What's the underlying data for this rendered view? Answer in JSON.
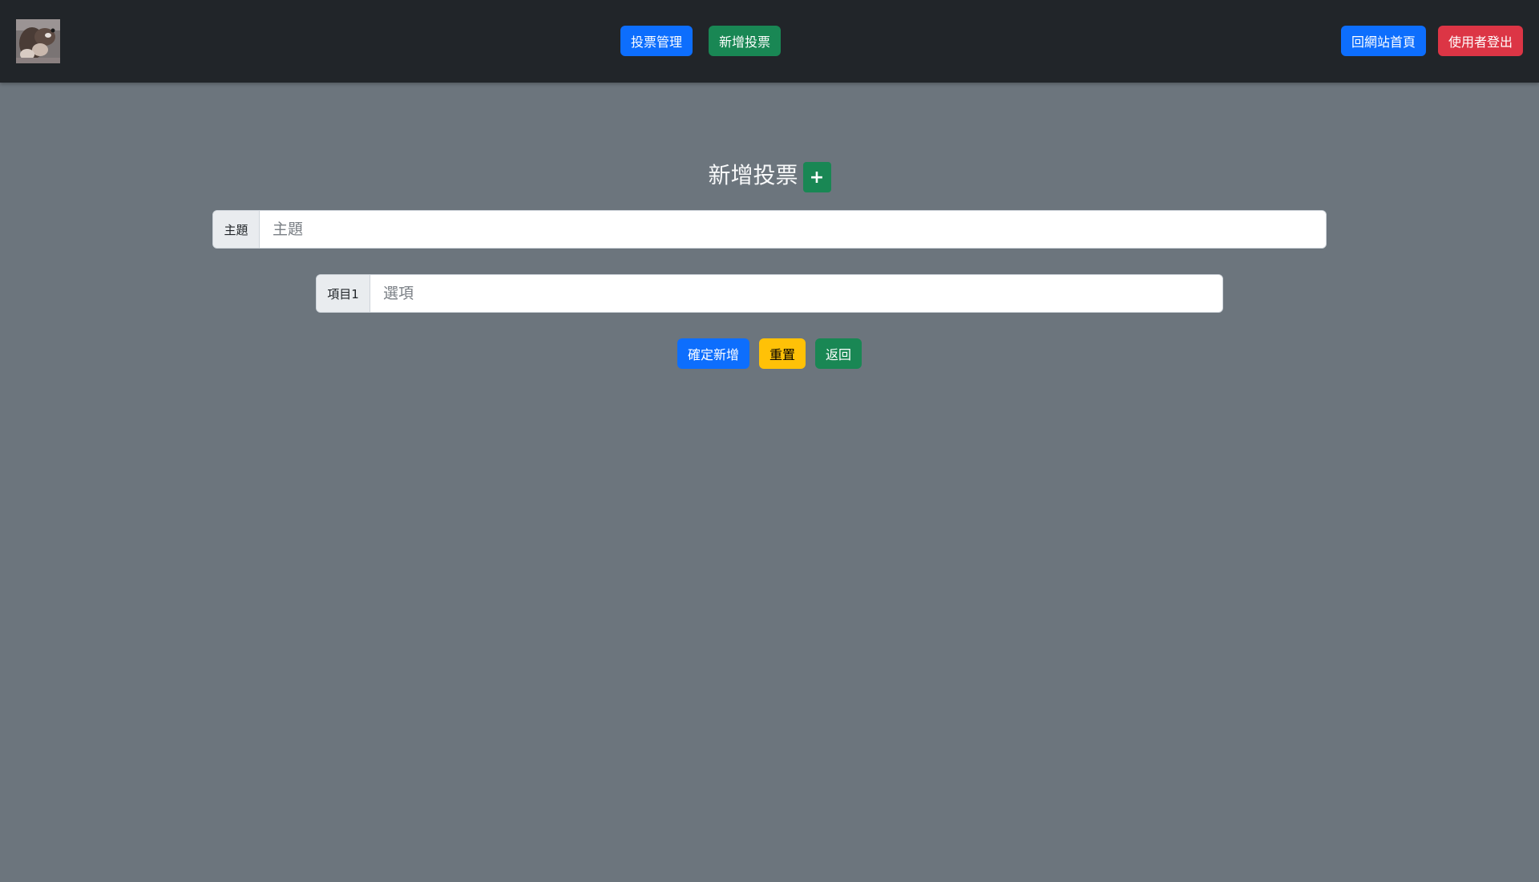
{
  "navbar": {
    "logo_alt": "otter-logo",
    "center_buttons": [
      {
        "label": "投票管理",
        "color": "#0d6efd"
      },
      {
        "label": "新增投票",
        "color": "#198754"
      }
    ],
    "right_buttons": [
      {
        "label": "回網站首頁",
        "color": "#0d6efd"
      },
      {
        "label": "使用者登出",
        "color": "#dc3545"
      }
    ]
  },
  "main": {
    "title": "新增投票",
    "add_icon": "+",
    "subject": {
      "label": "主題",
      "placeholder": "主題",
      "value": ""
    },
    "options": [
      {
        "label": "項目1",
        "placeholder": "選項",
        "value": ""
      }
    ],
    "actions": {
      "confirm_label": "確定新增",
      "reset_label": "重置",
      "back_label": "返回"
    }
  },
  "colors": {
    "page_bg": "#6c757d",
    "navbar_bg": "#212529",
    "primary": "#0d6efd",
    "success": "#198754",
    "danger": "#dc3545",
    "warning": "#ffc107"
  }
}
